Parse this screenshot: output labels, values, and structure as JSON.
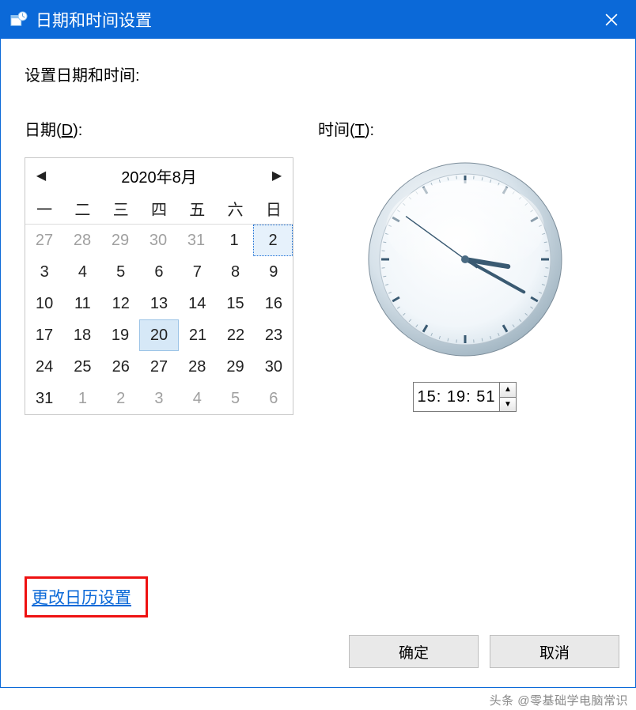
{
  "window": {
    "title": "日期和时间设置"
  },
  "heading": "设置日期和时间:",
  "date_section": {
    "label_prefix": "日期(",
    "label_key": "D",
    "label_suffix": "):"
  },
  "time_section": {
    "label_prefix": "时间(",
    "label_key": "T",
    "label_suffix": "):"
  },
  "calendar": {
    "title": "2020年8月",
    "dow": [
      "一",
      "二",
      "三",
      "四",
      "五",
      "六",
      "日"
    ],
    "weeks": [
      [
        {
          "n": "27",
          "other": true
        },
        {
          "n": "28",
          "other": true
        },
        {
          "n": "29",
          "other": true
        },
        {
          "n": "30",
          "other": true
        },
        {
          "n": "31",
          "other": true
        },
        {
          "n": "1"
        },
        {
          "n": "2",
          "selected": true
        }
      ],
      [
        {
          "n": "3"
        },
        {
          "n": "4"
        },
        {
          "n": "5"
        },
        {
          "n": "6"
        },
        {
          "n": "7"
        },
        {
          "n": "8"
        },
        {
          "n": "9"
        }
      ],
      [
        {
          "n": "10"
        },
        {
          "n": "11"
        },
        {
          "n": "12"
        },
        {
          "n": "13"
        },
        {
          "n": "14"
        },
        {
          "n": "15"
        },
        {
          "n": "16"
        }
      ],
      [
        {
          "n": "17"
        },
        {
          "n": "18"
        },
        {
          "n": "19"
        },
        {
          "n": "20",
          "today": true
        },
        {
          "n": "21"
        },
        {
          "n": "22"
        },
        {
          "n": "23"
        }
      ],
      [
        {
          "n": "24"
        },
        {
          "n": "25"
        },
        {
          "n": "26"
        },
        {
          "n": "27"
        },
        {
          "n": "28"
        },
        {
          "n": "29"
        },
        {
          "n": "30"
        }
      ],
      [
        {
          "n": "31"
        },
        {
          "n": "1",
          "other": true
        },
        {
          "n": "2",
          "other": true
        },
        {
          "n": "3",
          "other": true
        },
        {
          "n": "4",
          "other": true
        },
        {
          "n": "5",
          "other": true
        },
        {
          "n": "6",
          "other": true
        }
      ]
    ]
  },
  "clock": {
    "hour": 15,
    "minute": 19,
    "second": 51,
    "time_text": "15: 19: 51"
  },
  "link": {
    "label": "更改日历设置"
  },
  "buttons": {
    "ok": "确定",
    "cancel": "取消"
  },
  "watermark": "头条 @零基础学电脑常识"
}
